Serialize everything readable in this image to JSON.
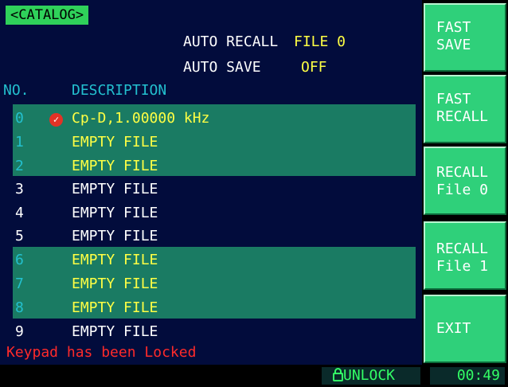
{
  "title": "<CATALOG>",
  "auto_recall": {
    "label": "AUTO RECALL",
    "value": "FILE 0"
  },
  "auto_save": {
    "label": "AUTO SAVE",
    "value": "OFF"
  },
  "columns": {
    "no": "NO.",
    "description": "DESCRIPTION"
  },
  "files": [
    {
      "no": "0",
      "description": "Cp-D,1.00000 kHz",
      "status_icon": "check-icon"
    },
    {
      "no": "1",
      "description": "EMPTY FILE"
    },
    {
      "no": "2",
      "description": "EMPTY FILE"
    },
    {
      "no": "3",
      "description": "EMPTY FILE"
    },
    {
      "no": "4",
      "description": "EMPTY FILE"
    },
    {
      "no": "5",
      "description": "EMPTY FILE"
    },
    {
      "no": "6",
      "description": "EMPTY FILE"
    },
    {
      "no": "7",
      "description": "EMPTY FILE"
    },
    {
      "no": "8",
      "description": "EMPTY FILE"
    },
    {
      "no": "9",
      "description": "EMPTY FILE"
    }
  ],
  "status_message": "Keypad has been Locked",
  "lock": {
    "icon": "lock-icon",
    "label": "UNLOCK"
  },
  "clock": "00:49",
  "softkeys": [
    {
      "line1": "FAST",
      "line2": "SAVE"
    },
    {
      "line1": "FAST",
      "line2": "RECALL"
    },
    {
      "line1": "RECALL",
      "line2": "File 0"
    },
    {
      "line1": "RECALL",
      "line2": "File 1"
    },
    {
      "line1": "EXIT",
      "line2": ""
    }
  ],
  "colors": {
    "background": "#020c3c",
    "highlight_band": "#1a7b63",
    "softkey": "#2fd07a",
    "title_tag": "#2fd15a",
    "value_text": "#ffff44",
    "index_text": "#23c0cf",
    "warning_text": "#ff2a2a",
    "status_green": "#33ff66"
  }
}
